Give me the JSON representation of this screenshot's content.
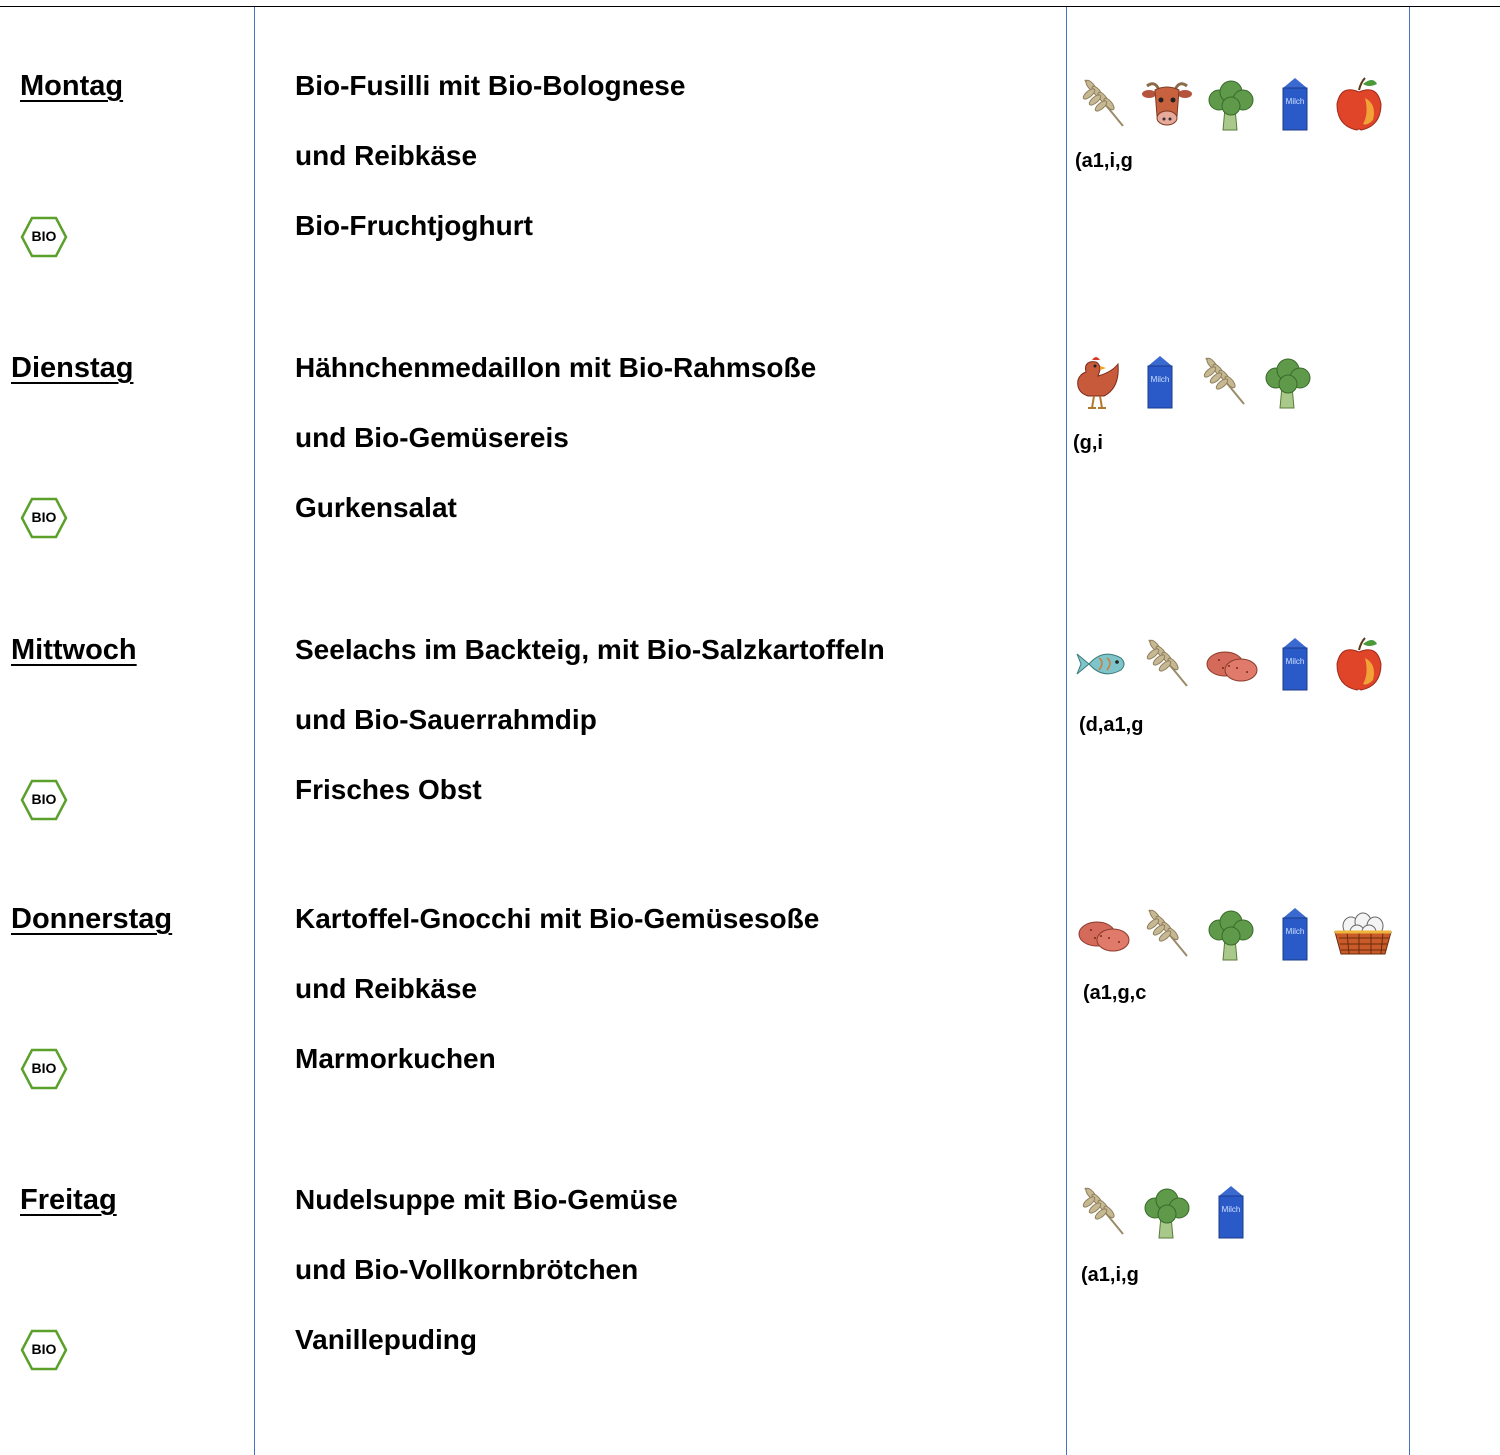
{
  "days": [
    {
      "name": "Montag",
      "lines": [
        "Bio-Fusilli mit Bio-Bolognese",
        "und Reibkäse",
        "Bio-Fruchtjoghurt"
      ],
      "icons": [
        "wheat-icon",
        "cow-icon",
        "broccoli-icon",
        "milk-carton-icon",
        "apple-icon"
      ],
      "allergens": "(a1,i,g",
      "milk_label": "Milch",
      "bio_label": "BIO"
    },
    {
      "name": "Dienstag",
      "lines": [
        "Hähnchenmedaillon mit Bio-Rahmsoße",
        "und Bio-Gemüsereis",
        "Gurkensalat"
      ],
      "icons": [
        "chicken-icon",
        "milk-carton-icon",
        "wheat-icon",
        "broccoli-icon"
      ],
      "allergens": "(g,i",
      "milk_label": "Milch",
      "bio_label": "BIO"
    },
    {
      "name": "Mittwoch",
      "lines": [
        "Seelachs im Backteig, mit Bio-Salzkartoffeln",
        "und Bio-Sauerrahmdip",
        "Frisches Obst"
      ],
      "icons": [
        "fish-icon",
        "wheat-icon",
        "potato-icon",
        "milk-carton-icon",
        "apple-icon"
      ],
      "allergens": "(d,a1,g",
      "milk_label": "Milch",
      "bio_label": "BIO"
    },
    {
      "name": "Donnerstag",
      "lines": [
        "Kartoffel-Gnocchi mit Bio-Gemüsesoße",
        "und Reibkäse",
        "Marmorkuchen"
      ],
      "icons": [
        "potato-icon",
        "wheat-icon",
        "broccoli-icon",
        "milk-carton-icon",
        "egg-basket-icon"
      ],
      "allergens": "(a1,g,c",
      "milk_label": "Milch",
      "bio_label": "BIO"
    },
    {
      "name": "Freitag",
      "lines": [
        "Nudelsuppe mit Bio-Gemüse",
        "und Bio-Vollkornbrötchen",
        "Vanillepuding"
      ],
      "icons": [
        "wheat-icon",
        "broccoli-icon",
        "milk-carton-icon"
      ],
      "allergens": "(a1,i,g",
      "milk_label": "Milch",
      "bio_label": "BIO"
    }
  ]
}
